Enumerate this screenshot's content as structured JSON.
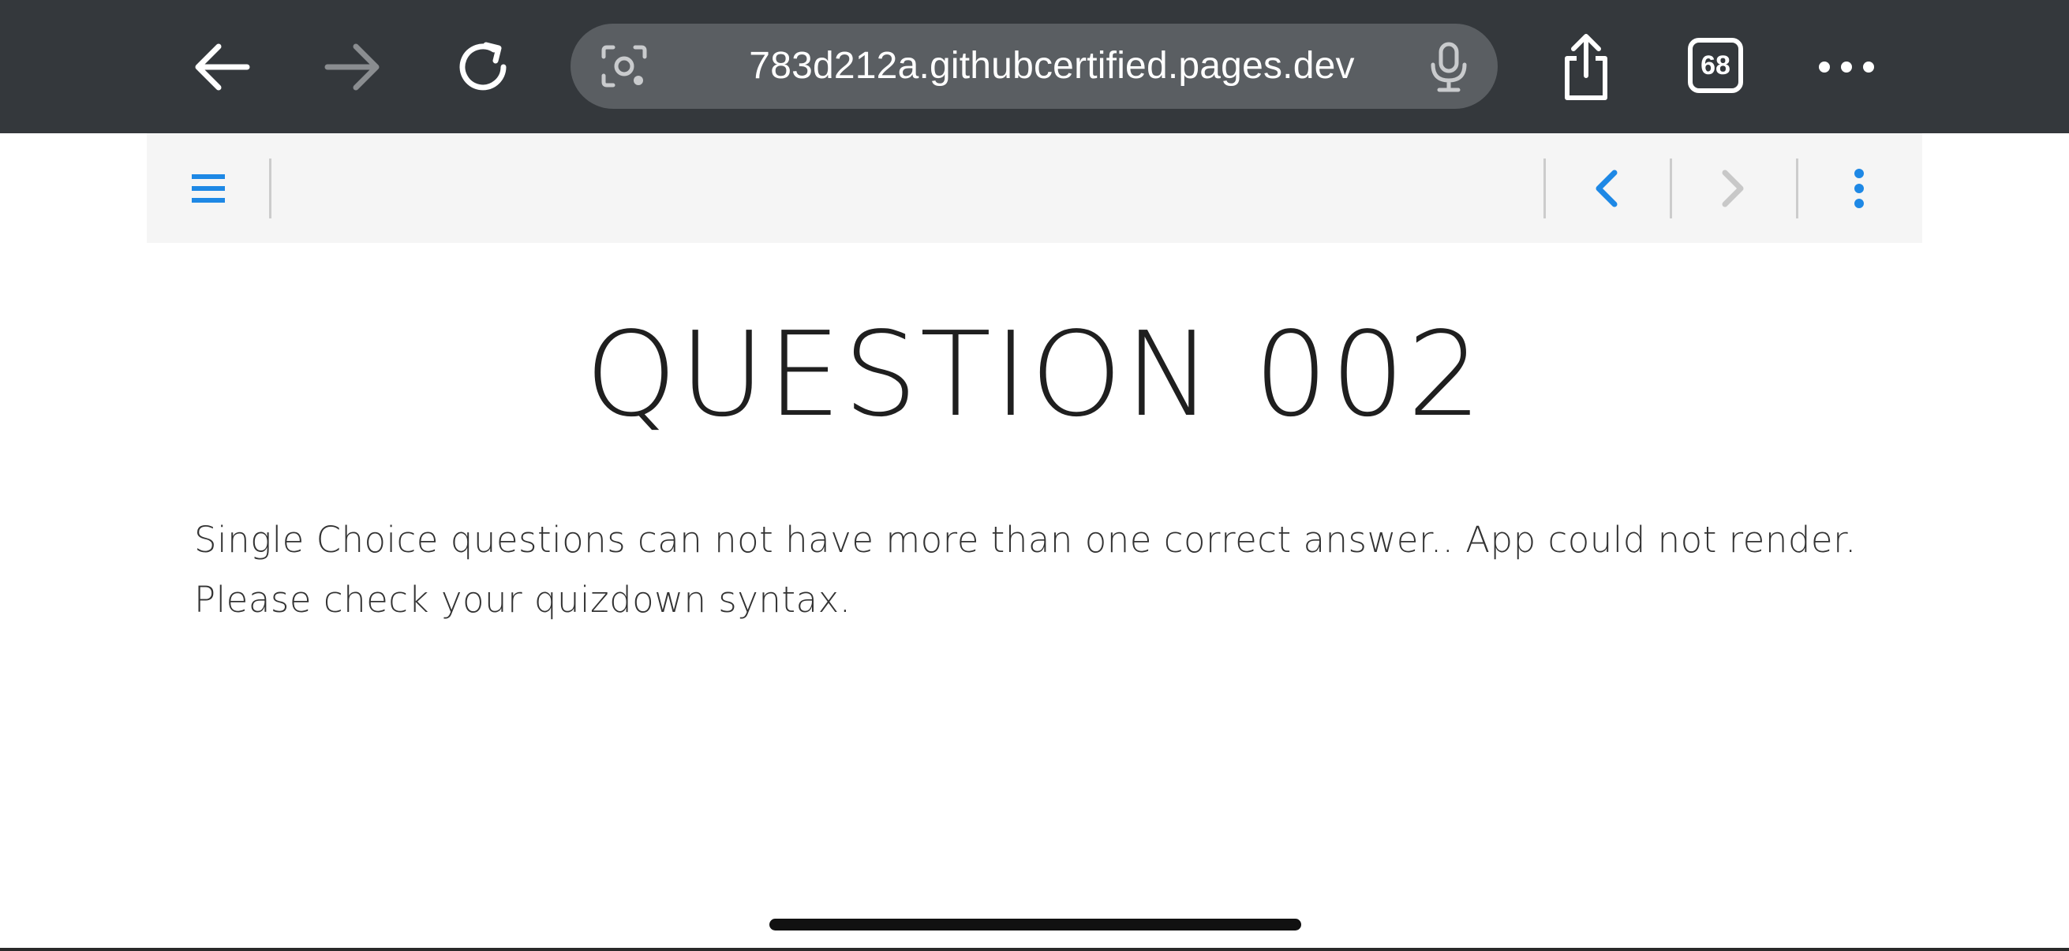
{
  "browser": {
    "url": "783d212a.githubcertified.pages.dev",
    "tab_count": "68",
    "icons": {
      "back": "arrow-left-icon",
      "forward": "arrow-right-icon",
      "reload": "reload-icon",
      "lens": "camera-lens-icon",
      "mic": "microphone-icon",
      "share": "share-icon",
      "more": "more-horizontal-icon"
    },
    "forward_enabled": false
  },
  "toolbar": {
    "icons": {
      "menu": "hamburger-menu-icon",
      "prev": "chevron-left-icon",
      "next": "chevron-right-icon",
      "more": "more-vertical-icon"
    },
    "accent_color": "#1e88e5",
    "next_enabled": false
  },
  "content": {
    "title": "QUESTION 002",
    "message": "Single Choice questions can not have more than one correct answer.. App could not render. Please check your quizdown syntax."
  }
}
